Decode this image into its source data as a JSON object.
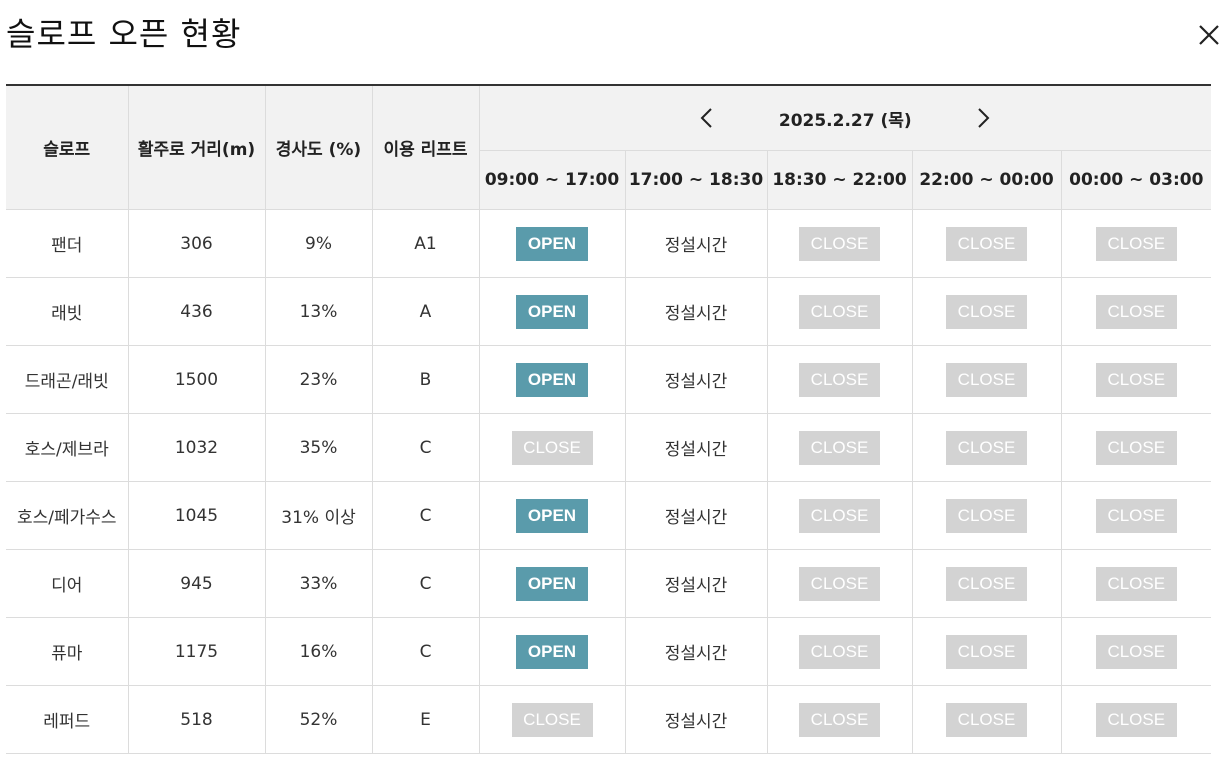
{
  "modal": {
    "title": "슬로프 오픈 현황"
  },
  "table": {
    "headers": {
      "slope": "슬로프",
      "length": "활주로 거리(m)",
      "grade": "경사도 (%)",
      "lift": "이용 리프트",
      "date": "2025.2.27 (목)"
    },
    "time_slots": [
      "09:00 ~ 17:00",
      "17:00 ~ 18:30",
      "18:30 ~ 22:00",
      "22:00 ~ 00:00",
      "00:00 ~ 03:00"
    ],
    "rows": [
      {
        "slope": "팬더",
        "length": "306",
        "grade": "9%",
        "lift": "A1",
        "status": [
          "OPEN",
          "정설시간",
          "CLOSE",
          "CLOSE",
          "CLOSE"
        ]
      },
      {
        "slope": "래빗",
        "length": "436",
        "grade": "13%",
        "lift": "A",
        "status": [
          "OPEN",
          "정설시간",
          "CLOSE",
          "CLOSE",
          "CLOSE"
        ]
      },
      {
        "slope": "드래곤/래빗",
        "length": "1500",
        "grade": "23%",
        "lift": "B",
        "status": [
          "OPEN",
          "정설시간",
          "CLOSE",
          "CLOSE",
          "CLOSE"
        ]
      },
      {
        "slope": "호스/제브라",
        "length": "1032",
        "grade": "35%",
        "lift": "C",
        "status": [
          "CLOSE",
          "정설시간",
          "CLOSE",
          "CLOSE",
          "CLOSE"
        ]
      },
      {
        "slope": "호스/페가수스",
        "length": "1045",
        "grade": "31% 이상",
        "lift": "C",
        "status": [
          "OPEN",
          "정설시간",
          "CLOSE",
          "CLOSE",
          "CLOSE"
        ]
      },
      {
        "slope": "디어",
        "length": "945",
        "grade": "33%",
        "lift": "C",
        "status": [
          "OPEN",
          "정설시간",
          "CLOSE",
          "CLOSE",
          "CLOSE"
        ]
      },
      {
        "slope": "퓨마",
        "length": "1175",
        "grade": "16%",
        "lift": "C",
        "status": [
          "OPEN",
          "정설시간",
          "CLOSE",
          "CLOSE",
          "CLOSE"
        ]
      },
      {
        "slope": "레퍼드",
        "length": "518",
        "grade": "52%",
        "lift": "E",
        "status": [
          "CLOSE",
          "정설시간",
          "CLOSE",
          "CLOSE",
          "CLOSE"
        ]
      }
    ]
  },
  "icons": {
    "close": "close-icon",
    "prev": "chevron-left-icon",
    "next": "chevron-right-icon"
  },
  "colors": {
    "open": "#5a9bab",
    "closed": "#d3d3d3",
    "header_bg": "#f2f2f2"
  }
}
